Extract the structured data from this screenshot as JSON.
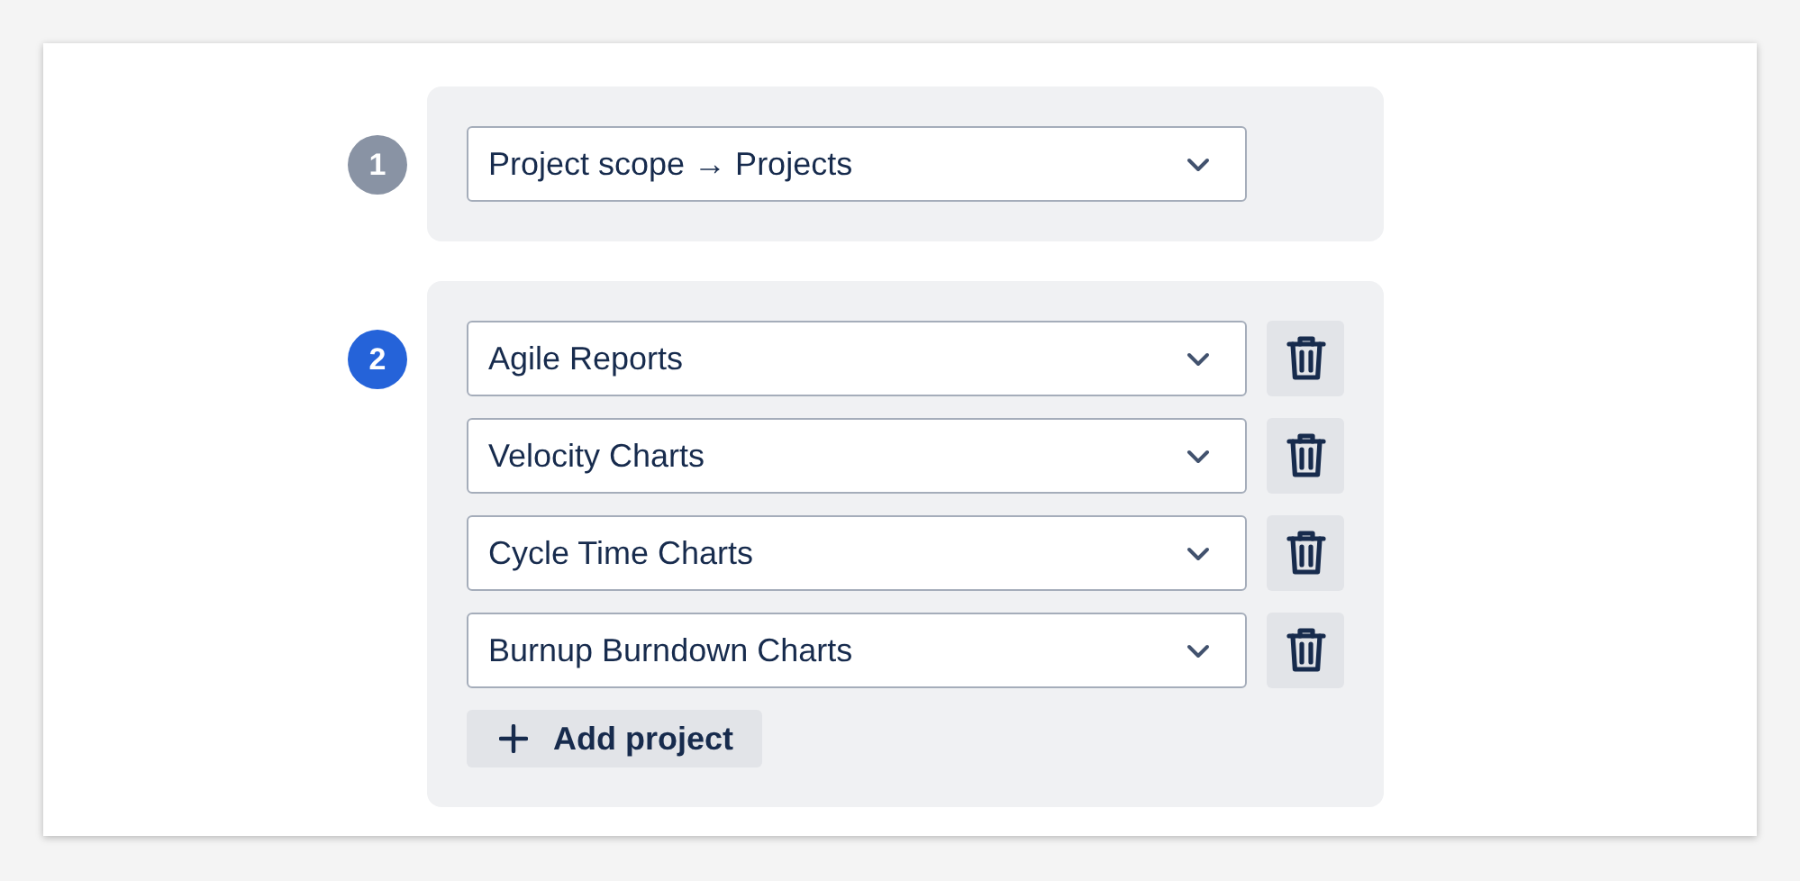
{
  "steps": [
    {
      "number": "1",
      "active": false,
      "selects": [
        {
          "value": "Project scope → Projects",
          "removable": false
        }
      ]
    },
    {
      "number": "2",
      "active": true,
      "selects": [
        {
          "value": "Agile Reports",
          "removable": true
        },
        {
          "value": "Velocity Charts",
          "removable": true
        },
        {
          "value": "Cycle Time Charts",
          "removable": true
        },
        {
          "value": "Burnup Burndown Charts",
          "removable": true
        }
      ],
      "add_button": {
        "label": "Add project"
      }
    }
  ]
}
